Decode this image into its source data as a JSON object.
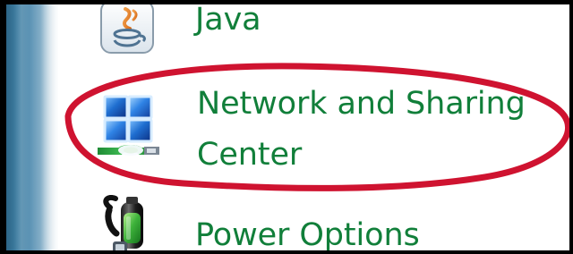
{
  "control_panel": {
    "items": [
      {
        "label": "Java",
        "icon": "java-icon"
      },
      {
        "label_lines": [
          "Network and Sharing",
          "Center"
        ],
        "icon": "network-sharing-icon",
        "highlighted": true
      },
      {
        "label": "Power Options",
        "icon": "power-options-icon"
      }
    ]
  },
  "annotation": {
    "highlight_color": "#d1132f"
  },
  "colors": {
    "label_text": "#117f3a",
    "sidebar_dark": "#2d6587",
    "sidebar_light": "#c5d7e3",
    "border": "#000000",
    "background": "#ffffff"
  }
}
